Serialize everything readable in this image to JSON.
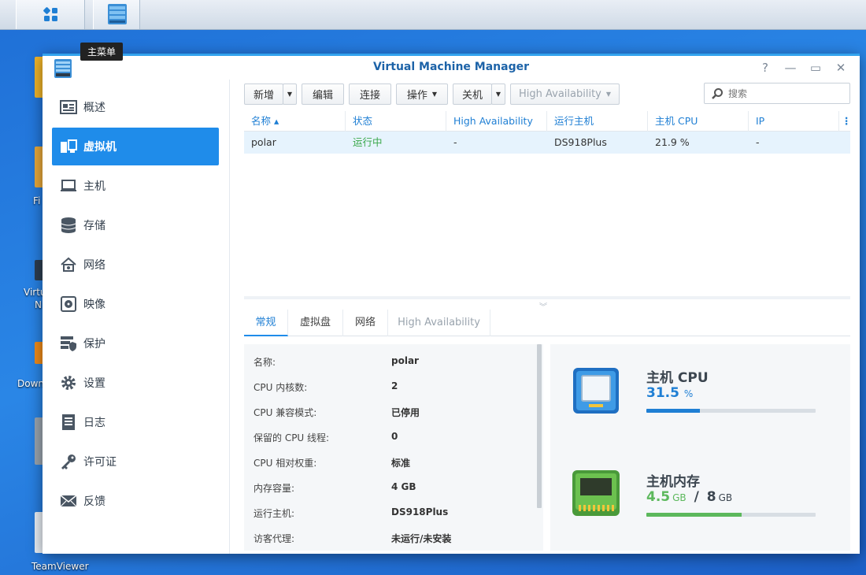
{
  "tooltip": "主菜单",
  "desktop": {
    "labels": [
      "Fi",
      "Virtu",
      "N",
      "Down",
      "TeamViewer"
    ]
  },
  "window": {
    "title": "Virtual Machine Manager",
    "controls": [
      "?",
      "—",
      "▭",
      "✕"
    ]
  },
  "sidebar": {
    "items": [
      {
        "label": "概述",
        "icon": "overview-icon"
      },
      {
        "label": "虚拟机",
        "icon": "virtual-machine-icon",
        "active": true
      },
      {
        "label": "主机",
        "icon": "host-icon"
      },
      {
        "label": "存储",
        "icon": "storage-icon"
      },
      {
        "label": "网络",
        "icon": "network-icon"
      },
      {
        "label": "映像",
        "icon": "image-icon"
      },
      {
        "label": "保护",
        "icon": "protection-icon"
      },
      {
        "label": "设置",
        "icon": "gear-icon"
      },
      {
        "label": "日志",
        "icon": "log-icon"
      },
      {
        "label": "许可证",
        "icon": "key-icon"
      },
      {
        "label": "反馈",
        "icon": "mail-icon"
      }
    ]
  },
  "toolbar": {
    "new": "新增",
    "edit": "编辑",
    "connect": "连接",
    "action": "操作",
    "shutdown": "关机",
    "ha": "High Availability",
    "search_placeholder": "搜索"
  },
  "grid": {
    "columns": [
      "名称 ▴",
      "状态",
      "High Availability",
      "运行主机",
      "主机 CPU",
      "IP"
    ],
    "rows": [
      {
        "name": "polar",
        "status": "运行中",
        "ha": "-",
        "host": "DS918Plus",
        "cpu": "21.9 %",
        "ip": "-"
      }
    ],
    "status_color": "#3aa84a"
  },
  "tabs": [
    "常规",
    "虚拟盘",
    "网络",
    "High Availability"
  ],
  "details": [
    {
      "label": "名称:",
      "value": "polar"
    },
    {
      "label": "CPU 内核数:",
      "value": "2"
    },
    {
      "label": "CPU 兼容模式:",
      "value": "已停用"
    },
    {
      "label": "保留的 CPU 线程:",
      "value": "0"
    },
    {
      "label": "CPU 相对权重:",
      "value": "标准"
    },
    {
      "label": "内存容量:",
      "value": "4 GB"
    },
    {
      "label": "运行主机:",
      "value": "DS918Plus"
    },
    {
      "label": "访客代理:",
      "value": "未运行/未安装"
    }
  ],
  "resources": {
    "cpu": {
      "title": "主机 CPU",
      "value": "31.5",
      "unit": "%",
      "fraction": 0.315,
      "color": "#1f7fd4"
    },
    "memory": {
      "title": "主机内存",
      "used": "4.5",
      "used_unit": "GB",
      "sep": "/",
      "total": "8",
      "total_unit": "GB",
      "fraction": 0.5625,
      "color": "#5cb85c"
    }
  }
}
